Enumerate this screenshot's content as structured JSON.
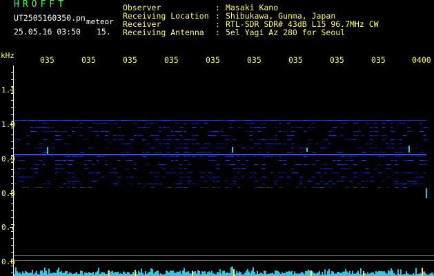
{
  "header": {
    "brand": "HROFFT",
    "filename": "UT2505160350.pn",
    "detection_label": "meteor",
    "datetime": "25.05.16 03:50",
    "count": "15."
  },
  "station": {
    "rows": [
      {
        "label": "Observer",
        "value": "Masaki Kano"
      },
      {
        "label": "Receiving Location",
        "value": "Shibukawa, Gunma, Japan"
      },
      {
        "label": "Receiver",
        "value": "RTL-SDR SDR# 43dB L15 96.7MHz CW"
      },
      {
        "label": "Receiving Antenna",
        "value": "5el Yagi Az 280 for Seoul"
      }
    ]
  },
  "spectrogram": {
    "unit_label": "kHz",
    "time_ticks": [
      "035",
      "035",
      "035",
      "035",
      "035",
      "035",
      "035",
      "035",
      "035",
      "0400"
    ],
    "freq_labels": [
      "1.1",
      "1.0",
      "0.9",
      "0.8",
      "0.7",
      "0.6"
    ],
    "colors": {
      "text": "#ffff66",
      "brand": "#44ff44",
      "signal": "#3355ff",
      "noise": "#33ddff",
      "background": "#000000"
    }
  }
}
